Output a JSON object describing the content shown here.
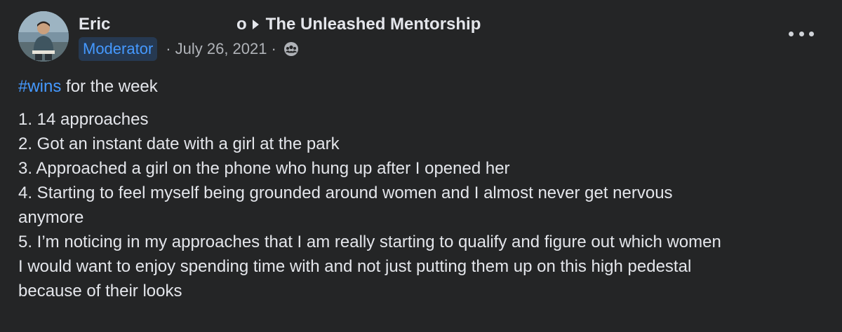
{
  "post": {
    "author": "Eric",
    "group_prefix": "o",
    "group_name": "The Unleashed Mentorship",
    "role": "Moderator",
    "date": "July 26, 2021",
    "separator": "·",
    "audience_icon": "group-audience-icon",
    "more_icon": "more-options-icon",
    "hashtag": "#wins",
    "intro_rest": " for the week",
    "lines": [
      "1. 14 approaches",
      "2. Got an instant date with a girl at the park",
      "3. Approached a girl on the phone who hung up after I opened her",
      "4. Starting to feel myself being grounded around women and I almost never get nervous",
      "anymore",
      "5. I’m noticing in my approaches that I am really starting to qualify and figure out which women",
      "I would want to enjoy spending time with and not just putting them up on this high pedestal",
      "because of their looks"
    ]
  },
  "colors": {
    "background": "#242526",
    "text": "#e4e6eb",
    "secondary_text": "#b0b3b8",
    "link": "#4599ff",
    "badge_background": "#263951"
  }
}
